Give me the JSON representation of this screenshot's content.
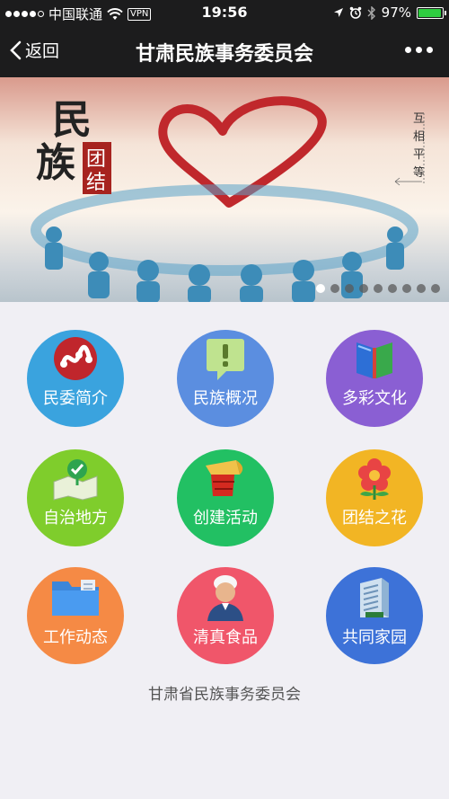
{
  "status": {
    "carrier": "中国联通",
    "vpn": "VPN",
    "time": "19:56",
    "battery": "97%",
    "battery_level": 0.97
  },
  "nav": {
    "back_label": "返回",
    "title": "甘肃民族事务委员会"
  },
  "banner": {
    "calligraphy_1": "民",
    "calligraphy_2": "族",
    "seal_1": "团",
    "seal_2": "结",
    "motto": "互相平等",
    "page_count": 9,
    "active_page": 0
  },
  "tiles": [
    {
      "label": "民委简介",
      "icon": "logo-icon",
      "color": "#3aa3de"
    },
    {
      "label": "民族概况",
      "icon": "notice-icon",
      "color": "#5b8ee0"
    },
    {
      "label": "多彩文化",
      "icon": "book-icon",
      "color": "#8a5fd3"
    },
    {
      "label": "自治地方",
      "icon": "map-pin-icon",
      "color": "#7fcd2c"
    },
    {
      "label": "创建活动",
      "icon": "trumpet-icon",
      "color": "#22c063"
    },
    {
      "label": "团结之花",
      "icon": "flower-icon",
      "color": "#f2b524"
    },
    {
      "label": "工作动态",
      "icon": "folder-icon",
      "color": "#f58a45"
    },
    {
      "label": "清真食品",
      "icon": "person-icon",
      "color": "#f0566a"
    },
    {
      "label": "共同家园",
      "icon": "building-icon",
      "color": "#3d72d8"
    }
  ],
  "footer": {
    "text": "甘肃省民族事务委员会"
  }
}
